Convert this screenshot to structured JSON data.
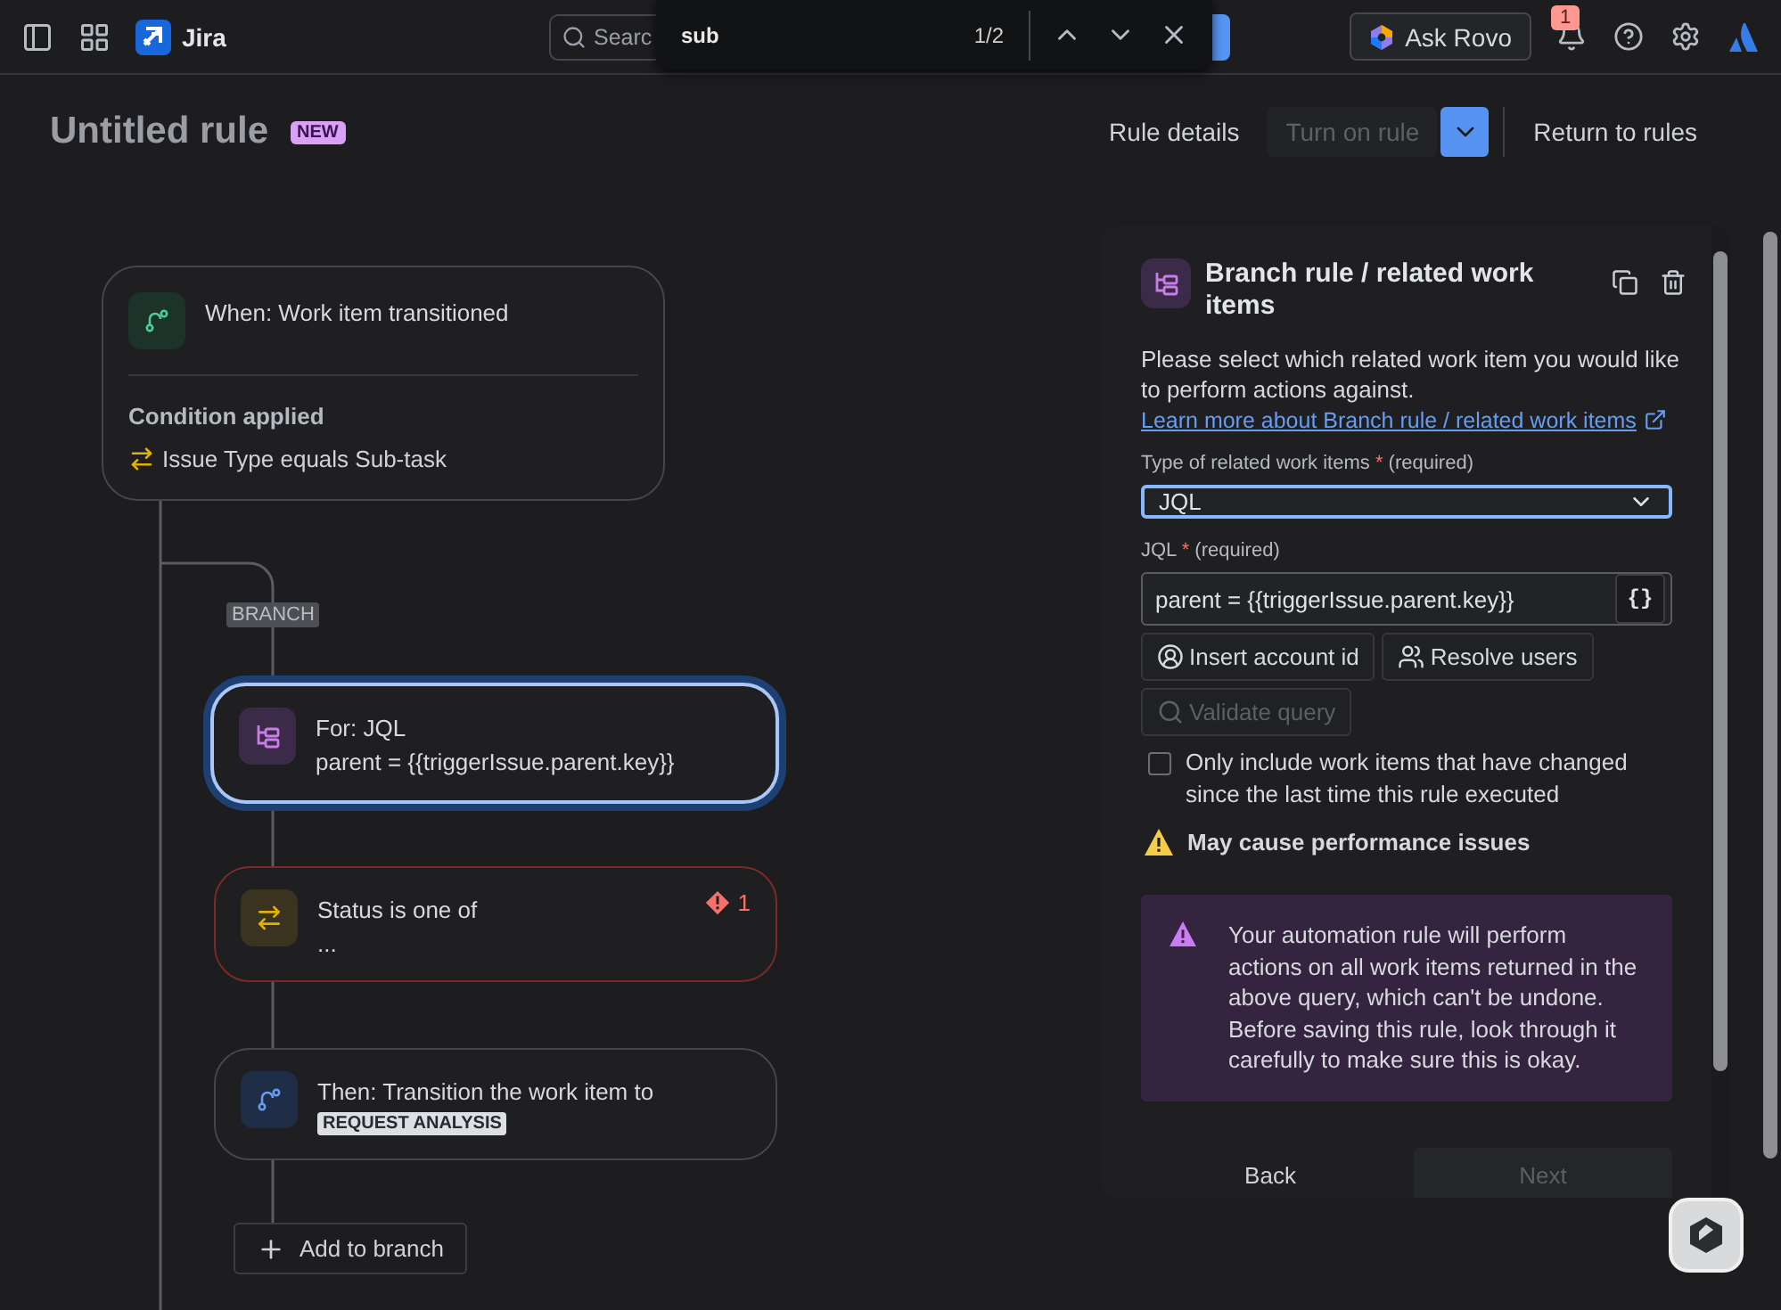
{
  "topbar": {
    "product": "Jira",
    "search": {
      "value": "Searc"
    },
    "find_bar": {
      "query": "sub",
      "count": "1/2"
    },
    "ask_button": "Ask Rovo",
    "notifications": {
      "badge": "1"
    }
  },
  "header": {
    "title": "Untitled rule",
    "badge": "NEW",
    "actions": [
      {
        "label": "Rule details",
        "kind": "link",
        "disabled": false
      },
      {
        "label": "Turn on rule",
        "kind": "split",
        "disabled": true
      },
      {
        "label": "Return to rules",
        "kind": "link",
        "disabled": false
      }
    ]
  },
  "canvas": {
    "trigger": {
      "title": "When: Work item transitioned",
      "condition_heading": "Condition applied",
      "condition": "Issue Type equals Sub-task"
    },
    "branch_label": "BRANCH",
    "steps": [
      {
        "kind": "branch",
        "title": "For: JQL",
        "detail": "parent = {{triggerIssue.parent.key}}",
        "selected": true
      },
      {
        "kind": "condition",
        "title": "Status is one of",
        "detail": "...",
        "selected": false,
        "error_count": "1"
      },
      {
        "kind": "action",
        "title": "Then: Transition the work item to",
        "tag": "REQUEST ANALYSIS",
        "selected": false
      }
    ],
    "add_button": "Add to branch"
  },
  "panel": {
    "title": "Branch rule / related work items",
    "description": "Please select which related work item you would like to perform actions against.",
    "link": "Learn more about Branch rule / related work items",
    "type_field": {
      "label": "Type of related work items",
      "required_mark": "*",
      "required_note": "(required)",
      "value": "JQL"
    },
    "jql_field": {
      "label": "JQL",
      "required_mark": "*",
      "required_note": "(required)",
      "value": "parent = {{triggerIssue.parent.key}}",
      "smart_values_button": "{}"
    },
    "tools": [
      {
        "label": "Insert account id",
        "kind": "account",
        "disabled": false
      },
      {
        "label": "Resolve users",
        "kind": "users",
        "disabled": false
      },
      {
        "label": "Validate query",
        "kind": "validate",
        "disabled": true
      }
    ],
    "checkbox": {
      "label": "Only include work items that have changed since the last time this rule executed",
      "checked": false
    },
    "warning": "May cause performance issues",
    "notice": "Your automation rule will perform actions on all work items returned in the above query, which can't be undone. Before saving this rule, look through it carefully to make sure this is okay.",
    "footer": [
      {
        "label": "Back",
        "disabled": false
      },
      {
        "label": "Next",
        "disabled": true
      }
    ]
  }
}
